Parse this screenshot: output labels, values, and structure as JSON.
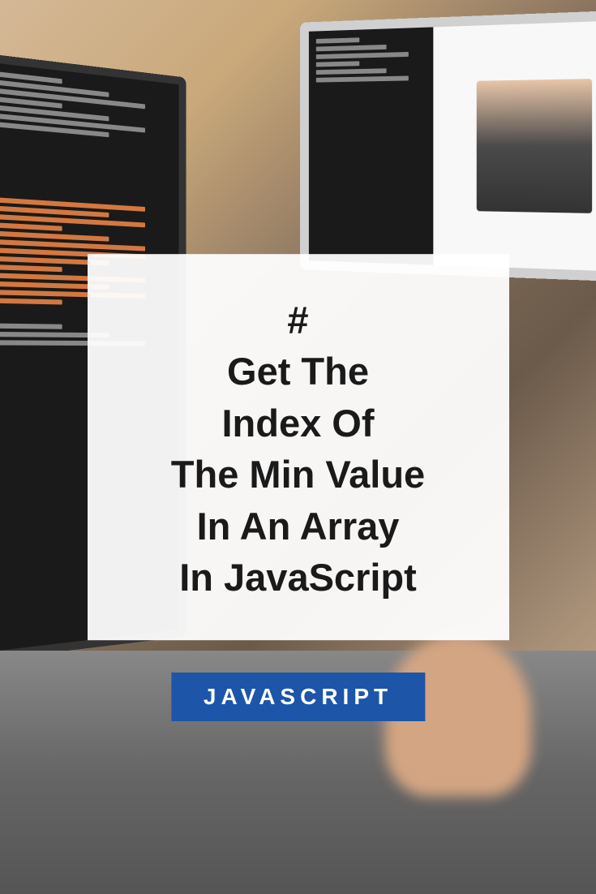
{
  "card": {
    "hash": "#",
    "line1": "Get The",
    "line2": "Index Of",
    "line3": "The Min Value",
    "line4": "In An Array",
    "line5": "In JavaScript"
  },
  "badge": {
    "label": "JAVASCRIPT"
  },
  "colors": {
    "badge_bg": "#1d55a8",
    "card_bg": "rgba(255,255,255,0.94)",
    "text": "#1a1a1a"
  }
}
